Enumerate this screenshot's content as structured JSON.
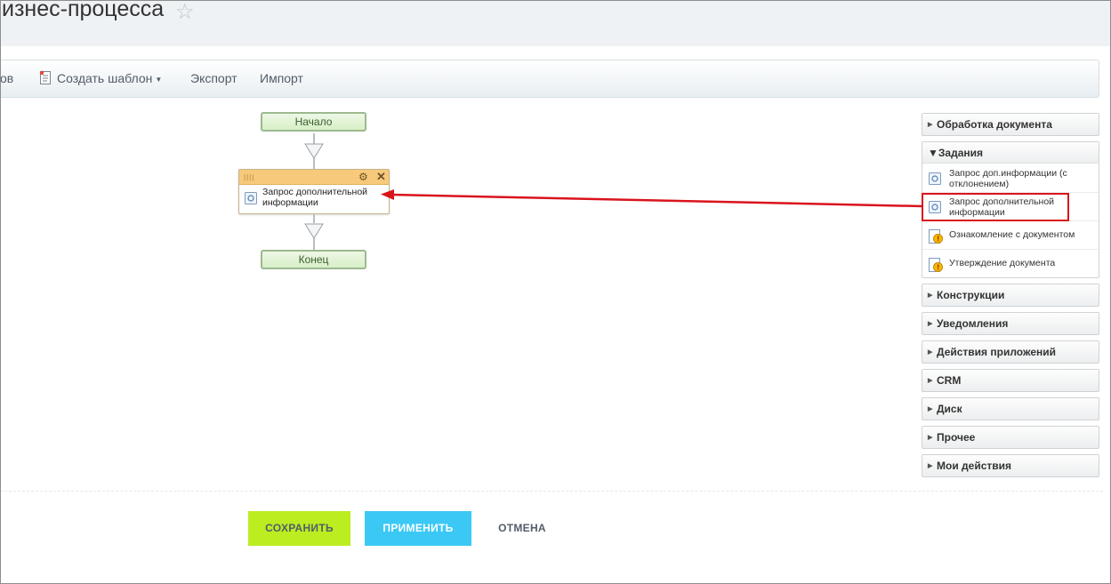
{
  "header": {
    "title": "изнес-процесса"
  },
  "toolbar": {
    "left_partial": "ов",
    "create_template": "Создать шаблон",
    "export": "Экспорт",
    "import": "Импорт"
  },
  "diagram": {
    "start": "Начало",
    "activity_label": "Запрос дополнительной информации",
    "end": "Конец"
  },
  "panel": {
    "sections_top": [
      "Обработка документа"
    ],
    "tasks": {
      "title": "Задания",
      "items": [
        "Запрос доп.информации (с отклонением)",
        "Запрос дополнительной информации",
        "Ознакомление с документом",
        "Утверждение документа"
      ]
    },
    "sections_bottom": [
      "Конструкции",
      "Уведомления",
      "Действия приложений",
      "CRM",
      "Диск",
      "Прочее",
      "Мои действия"
    ]
  },
  "buttons": {
    "save": "СОХРАНИТЬ",
    "apply": "ПРИМЕНИТЬ",
    "cancel": "ОТМЕНА"
  },
  "colors": {
    "highlight": "#d9141c",
    "save": "#bbed21",
    "apply": "#3bc8f5"
  }
}
